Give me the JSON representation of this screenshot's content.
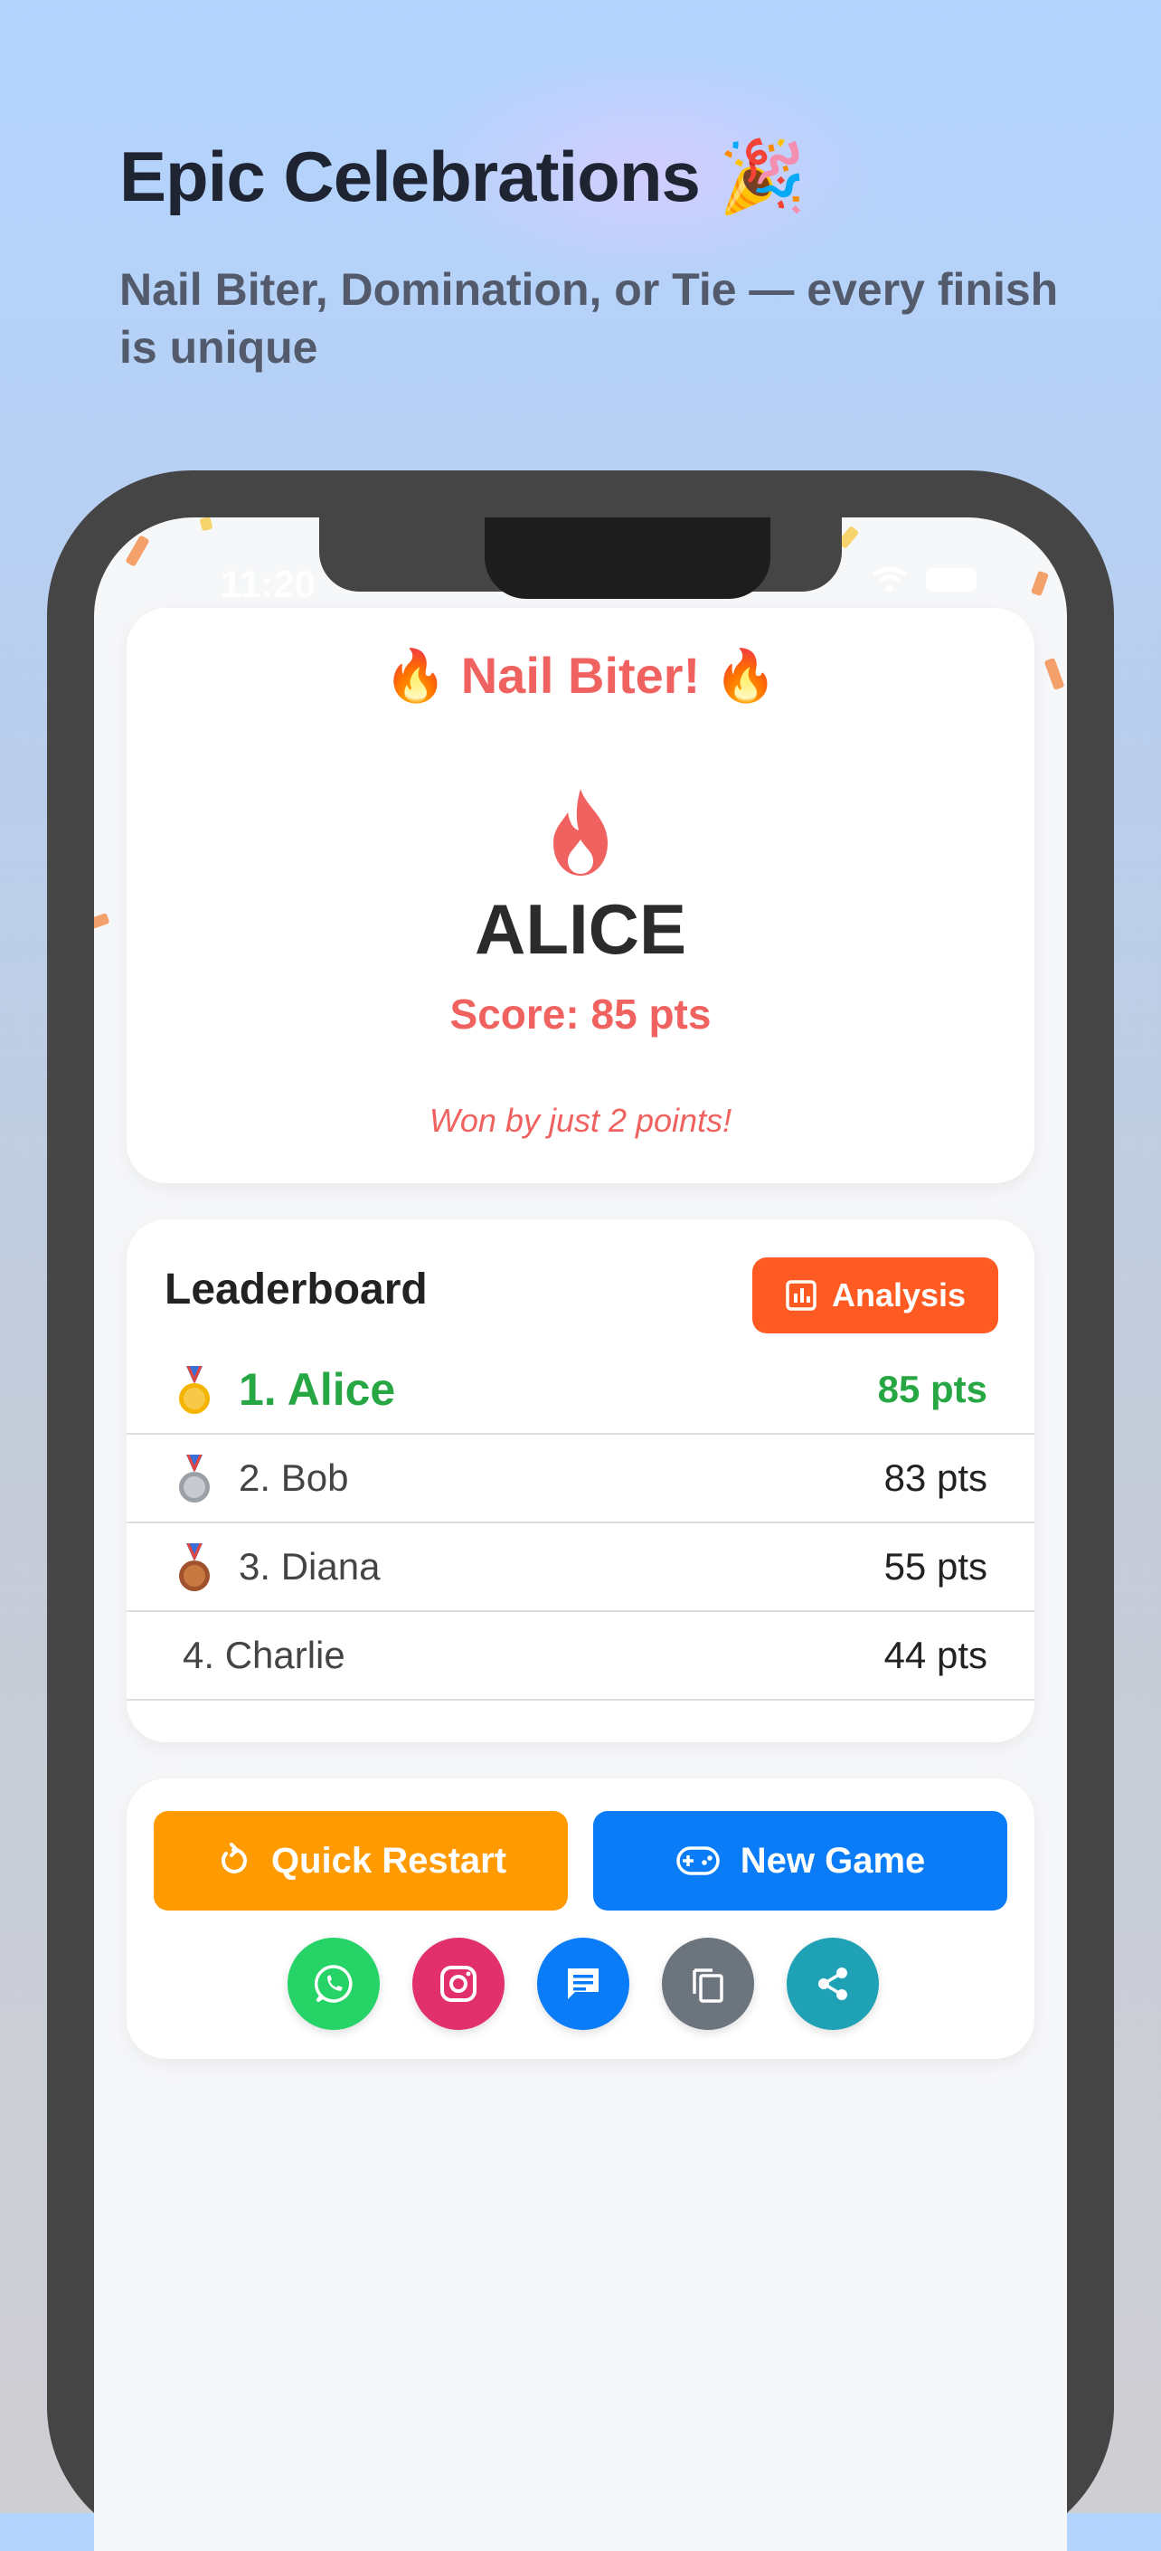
{
  "promo": {
    "title": "Epic Celebrations",
    "title_emoji": "🎉",
    "subtitle": "Nail Biter, Domination, or Tie — every finish is unique"
  },
  "status_bar": {
    "time": "11:20"
  },
  "winner": {
    "celebration": "🔥 Nail Biter! 🔥",
    "icon": "flame-icon",
    "name": "ALICE",
    "score": "Score: 85 pts",
    "note": "Won by just 2 points!"
  },
  "leaderboard": {
    "title": "Leaderboard",
    "analysis_label": "Analysis",
    "rows": [
      {
        "rank_name": "1. Alice",
        "score": "85 pts",
        "medal": "gold"
      },
      {
        "rank_name": "2. Bob",
        "score": "83 pts",
        "medal": "silver"
      },
      {
        "rank_name": "3. Diana",
        "score": "55 pts",
        "medal": "bronze"
      },
      {
        "rank_name": "4. Charlie",
        "score": "44 pts",
        "medal": ""
      }
    ]
  },
  "actions": {
    "restart_label": "Quick Restart",
    "new_game_label": "New Game",
    "share": [
      {
        "icon": "whatsapp-icon",
        "color": "#25d366"
      },
      {
        "icon": "instagram-icon",
        "color": "#e1306c"
      },
      {
        "icon": "message-icon",
        "color": "#0a7cf7"
      },
      {
        "icon": "copy-icon",
        "color": "#6c757d"
      },
      {
        "icon": "share-icon",
        "color": "#1fa2b5"
      }
    ]
  },
  "colors": {
    "accent_red": "#f0625f",
    "winner_green": "#27a744",
    "analysis_orange": "#ff5a22",
    "restart_orange": "#ff9a00",
    "new_game_blue": "#0a7cf7"
  }
}
